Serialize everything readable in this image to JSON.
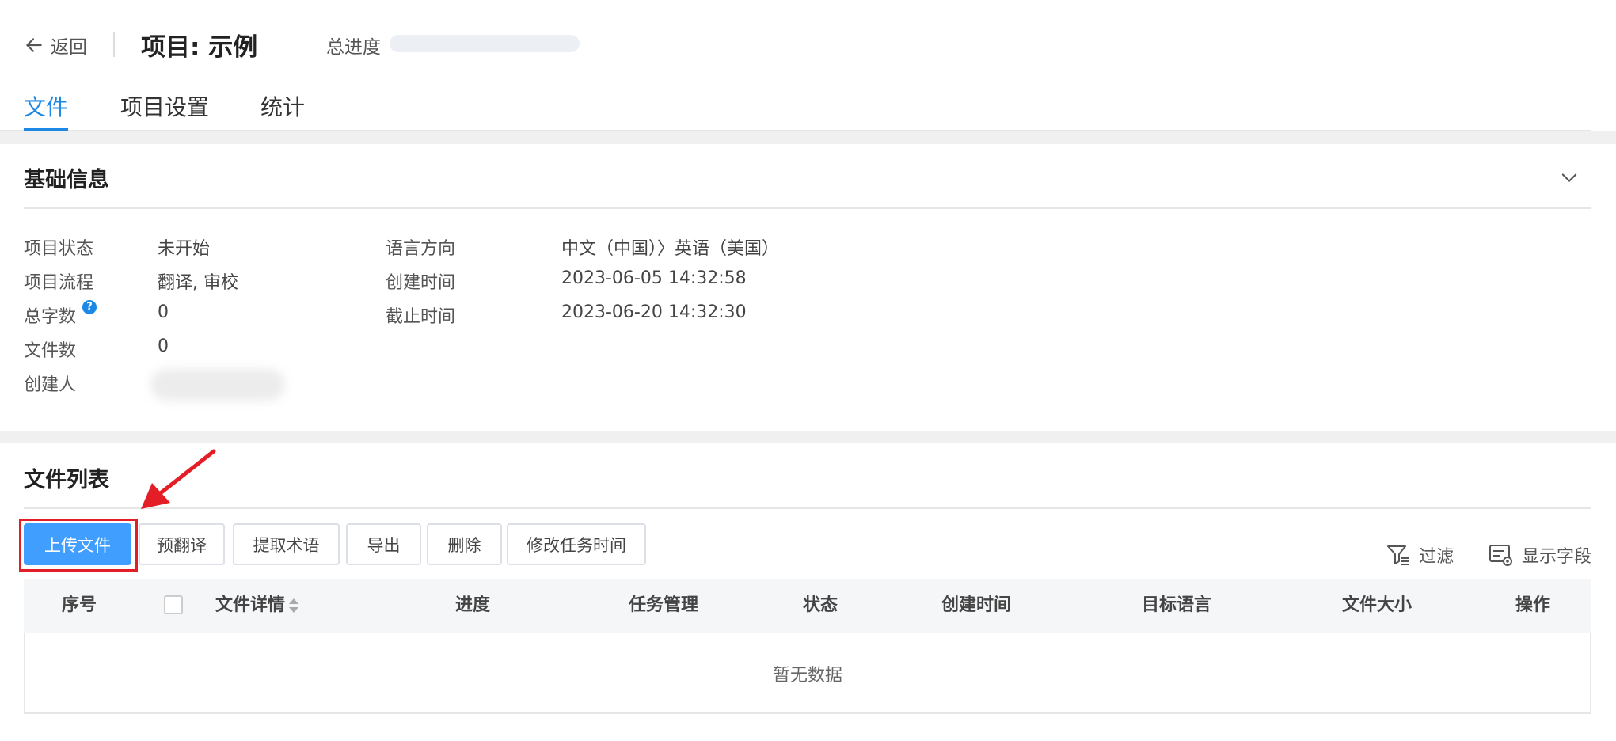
{
  "header": {
    "back_label": "返回",
    "project_title": "项目: 示例",
    "progress_label": "总进度",
    "progress_value": 0
  },
  "tabs": [
    {
      "label": "文件",
      "active": true
    },
    {
      "label": "项目设置",
      "active": false
    },
    {
      "label": "统计",
      "active": false
    }
  ],
  "basic_info": {
    "title": "基础信息",
    "left": [
      {
        "label": "项目状态",
        "value": "未开始"
      },
      {
        "label": "项目流程",
        "value": "翻译, 审校"
      },
      {
        "label": "总字数",
        "value": "0"
      },
      {
        "label": "文件数",
        "value": "0"
      },
      {
        "label": "创建人",
        "value": ""
      }
    ],
    "right": [
      {
        "label": "语言方向",
        "value": "中文（中国）〉英语（美国）"
      },
      {
        "label": "创建时间",
        "value": "2023-06-05 14:32:58"
      },
      {
        "label": "截止时间",
        "value": "2023-06-20 14:32:30"
      }
    ],
    "help_glyph": "?"
  },
  "file_list": {
    "title": "文件列表",
    "buttons": {
      "upload": "上传文件",
      "pretranslate": "预翻译",
      "extract_terms": "提取术语",
      "export": "导出",
      "delete": "删除",
      "modify_time": "修改任务时间"
    },
    "filter_label": "过滤",
    "fields_label": "显示字段",
    "columns": [
      "序号",
      "文件详情",
      "进度",
      "任务管理",
      "状态",
      "创建时间",
      "目标语言",
      "文件大小",
      "操作"
    ],
    "empty_text": "暂无数据"
  },
  "colors": {
    "accent": "#1e88e5",
    "primary_button": "#409eff",
    "annotation_red": "#e41e26"
  },
  "icons": [
    "arrow-left-icon",
    "chevron-down-icon",
    "help-icon",
    "filter-icon",
    "display-fields-icon",
    "sort-icon"
  ]
}
